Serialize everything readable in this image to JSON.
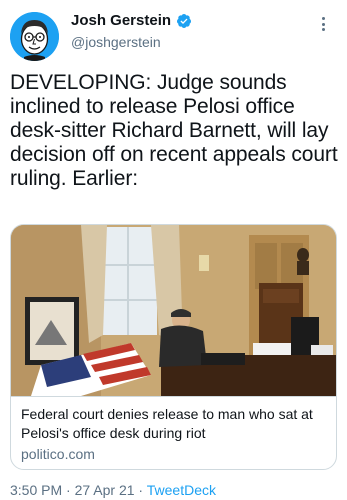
{
  "tweet": {
    "author": {
      "display_name": "Josh Gerstein",
      "handle": "@joshgerstein",
      "verified": true
    },
    "text": "DEVELOPING: Judge sounds inclined to release Pelosi office desk-sitter Richard Barnett, will lay decision off on recent appeals court ruling. Earlier:",
    "card": {
      "title": "Federal court denies release to man who sat at Pelosi's office desk during riot",
      "domain": "politico.com"
    },
    "meta": {
      "time": "3:50 PM",
      "separator": "·",
      "date": "27 Apr 21",
      "source": "TweetDeck"
    }
  },
  "colors": {
    "accent": "#1da1f2",
    "secondary_text": "#5b7083",
    "border": "#cfd9de"
  },
  "icons": {
    "verified": "verified-badge-icon",
    "more": "more-options-icon"
  }
}
